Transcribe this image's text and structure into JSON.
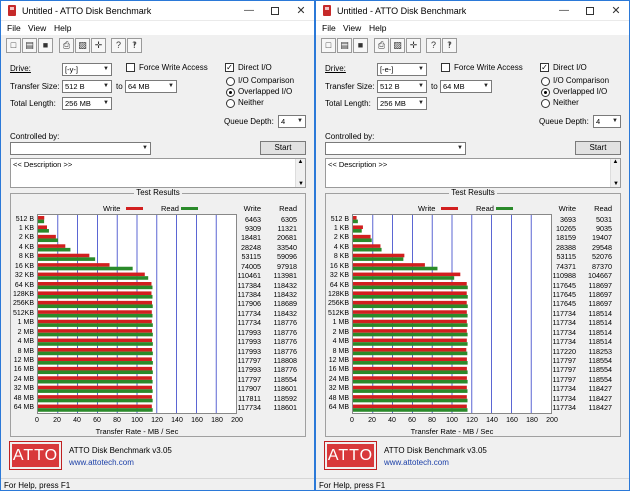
{
  "colors": {
    "write": "#d21f1f",
    "read": "#2a8a2a",
    "grid": "#3240c8",
    "logo": "#d8383a"
  },
  "common": {
    "menu": [
      "File",
      "View",
      "Help"
    ],
    "toolbar_icons": [
      "new-file-icon",
      "open-folder-icon",
      "save-icon",
      "print-icon",
      "print-preview-icon",
      "move-icon",
      "help-icon",
      "whats-this-icon"
    ],
    "drive_label": "Drive:",
    "force_write_label": "Force Write Access",
    "direct_io_label": "Direct I/O",
    "transfer_size_label": "Transfer Size:",
    "to_label": "to",
    "total_length_label": "Total Length:",
    "io_comparison_label": "I/O Comparison",
    "overlapped_label": "Overlapped I/O",
    "neither_label": "Neither",
    "queue_depth_label": "Queue Depth:",
    "controlled_by_label": "Controlled by:",
    "start_label": "Start",
    "description": "<< Description >>",
    "test_results_label": "Test Results",
    "write_legend": "Write",
    "read_legend": "Read",
    "write_col": "Write",
    "read_col": "Read",
    "x_axis_label": "Transfer Rate - MB / Sec",
    "x_ticks": [
      "0",
      "20",
      "40",
      "60",
      "80",
      "100",
      "120",
      "140",
      "160",
      "180",
      "200"
    ],
    "logo_text": "ATTO",
    "product": "ATTO Disk Benchmark v3.05",
    "website": "www.attotech.com",
    "status": "For Help, press F1",
    "categories": [
      "512 B",
      "1 KB",
      "2 KB",
      "4 KB",
      "8 KB",
      "16 KB",
      "32 KB",
      "64 KB",
      "128KB",
      "256KB",
      "512KB",
      "1 MB",
      "2 MB",
      "4 MB",
      "8 MB",
      "12 MB",
      "16 MB",
      "24 MB",
      "32 MB",
      "48 MB",
      "64 MB"
    ]
  },
  "windows": [
    {
      "title": "Untitled - ATTO Disk Benchmark",
      "drive": "[-y-]",
      "transfer_from": "512 B",
      "transfer_to": "64 MB",
      "total_length": "256 MB",
      "queue_depth": "4",
      "chart_data": {
        "type": "bar",
        "xlabel": "Transfer Rate - MB / Sec",
        "xlim": [
          0,
          200
        ],
        "series": [
          {
            "name": "Write",
            "values": [
              6463,
              9309,
              18481,
              28248,
              53115,
              74005,
              110461,
              117384,
              117384,
              117906,
              117734,
              117734,
              117993,
              117993,
              117993,
              117797,
              117993,
              117797,
              117907,
              117811,
              117734
            ]
          },
          {
            "name": "Read",
            "values": [
              6305,
              11321,
              20681,
              33540,
              59096,
              97918,
              113981,
              118432,
              118432,
              118689,
              118432,
              118776,
              118776,
              118776,
              118776,
              118808,
              118776,
              118554,
              118601,
              118592,
              118601
            ]
          }
        ]
      }
    },
    {
      "title": "Untitled - ATTO Disk Benchmark",
      "drive": "[-e-]",
      "transfer_from": "512 B",
      "transfer_to": "64 MB",
      "total_length": "256 MB",
      "queue_depth": "4",
      "chart_data": {
        "type": "bar",
        "xlabel": "Transfer Rate - MB / Sec",
        "xlim": [
          0,
          200
        ],
        "series": [
          {
            "name": "Write",
            "values": [
              3693,
              10265,
              18159,
              28388,
              53115,
              74371,
              110988,
              117645,
              117645,
              117645,
              117734,
              117734,
              117734,
              117734,
              117220,
              117797,
              117797,
              117797,
              117734,
              117734,
              117734
            ]
          },
          {
            "name": "Read",
            "values": [
              5031,
              9035,
              19407,
              29548,
              52076,
              87370,
              104667,
              118697,
              118697,
              118697,
              118514,
              118514,
              118514,
              118514,
              118253,
              118554,
              118554,
              118554,
              118427,
              118427,
              118427
            ]
          }
        ]
      }
    }
  ]
}
